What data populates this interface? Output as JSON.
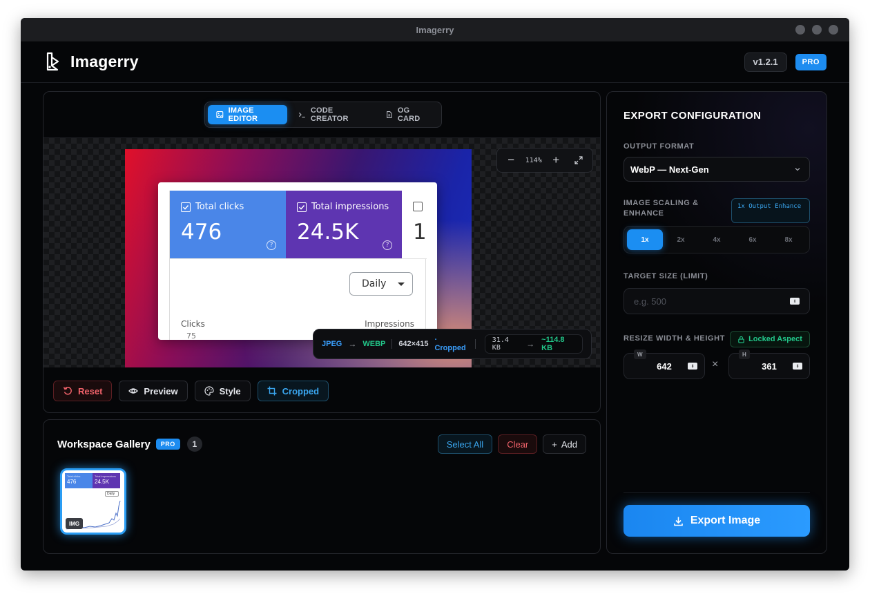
{
  "window": {
    "title": "Imagerry"
  },
  "app": {
    "name": "Imagerry",
    "version": "v1.2.1",
    "plan_badge": "PRO"
  },
  "editor": {
    "tabs": [
      {
        "label": "IMAGE EDITOR",
        "icon": "image-icon",
        "active": true
      },
      {
        "label": "CODE CREATOR",
        "icon": "terminal-icon",
        "active": false
      },
      {
        "label": "OG CARD",
        "icon": "file-icon",
        "active": false
      }
    ],
    "zoom": {
      "value": "114%"
    },
    "preview": {
      "metrics": [
        {
          "label": "Total clicks",
          "value": "476",
          "color": "#4a86e8"
        },
        {
          "label": "Total impressions",
          "value": "24.5K",
          "color": "#5e35b1"
        },
        {
          "label": "",
          "value": "1"
        }
      ],
      "range_select": "Daily",
      "left_axis_label": "Clicks",
      "left_axis_value": "75",
      "right_axis_label": "Impressions"
    },
    "conversion": {
      "from_format": "JPEG",
      "to_format": "WEBP",
      "dimensions": "642×415",
      "state": "· Cropped",
      "original_size": "31.4 KB",
      "new_size": "~114.8 KB"
    },
    "toolbar": {
      "reset": "Reset",
      "preview": "Preview",
      "style": "Style",
      "cropped": "Cropped"
    }
  },
  "gallery": {
    "title": "Workspace Gallery",
    "badge": "PRO",
    "count": "1",
    "select_all": "Select All",
    "clear": "Clear",
    "add": "Add",
    "items": [
      {
        "type_tag": "IMG",
        "clicks": "476",
        "impressions": "24.5K",
        "range": "Daily"
      }
    ]
  },
  "export": {
    "title": "EXPORT CONFIGURATION",
    "output_format_label": "OUTPUT FORMAT",
    "output_format_value": "WebP — Next-Gen",
    "scaling_label": "IMAGE SCALING & ENHANCE",
    "scaling_note": "1x Output Enhance",
    "scale_options": [
      "1x",
      "2x",
      "4x",
      "6x",
      "8x"
    ],
    "scale_selected": "1x",
    "target_size_label": "TARGET SIZE (LIMIT)",
    "target_size_placeholder": "e.g. 500",
    "resize_label": "RESIZE WIDTH & HEIGHT",
    "locked_label": "Locked Aspect",
    "width_tag": "W",
    "width_value": "642",
    "height_tag": "H",
    "height_value": "361",
    "times_symbol": "×",
    "export_button": "Export Image"
  },
  "colors": {
    "accent": "#1b8ef2",
    "success": "#22c78a",
    "danger": "#f0626a",
    "background": "#050608"
  }
}
